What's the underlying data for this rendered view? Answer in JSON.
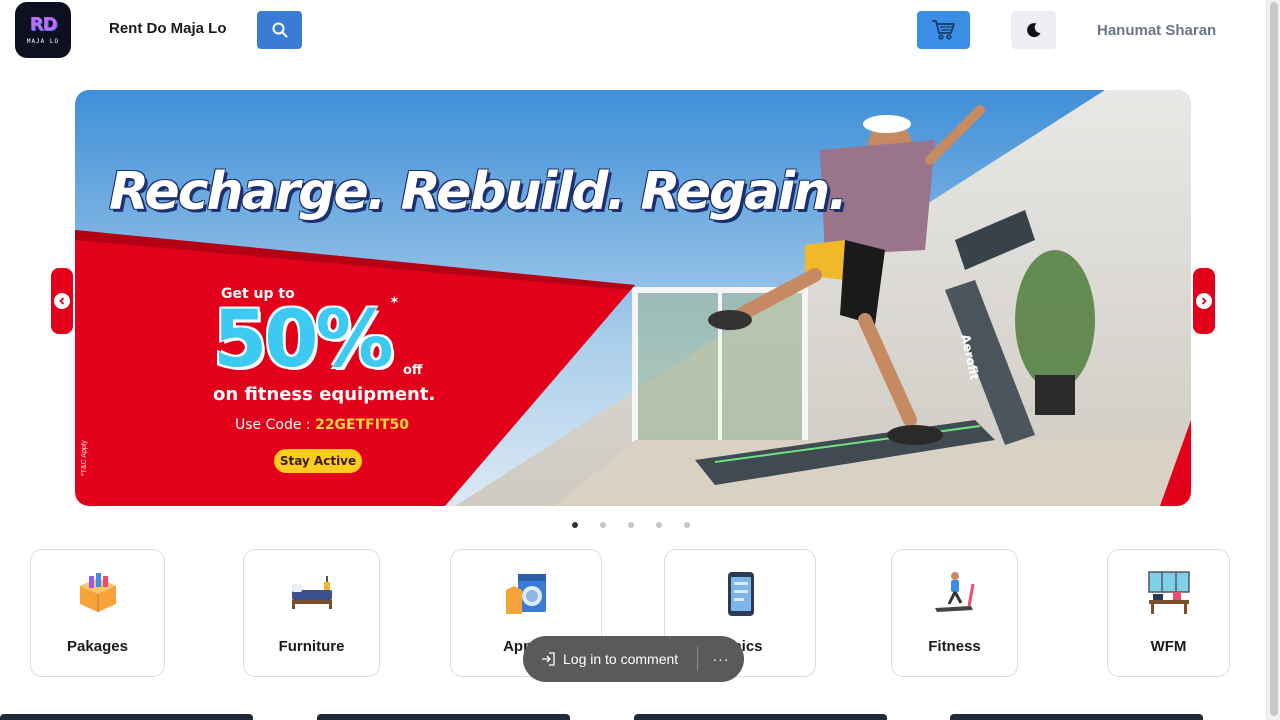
{
  "header": {
    "logo_mark": "RD",
    "logo_text": "MAJA LO",
    "site_title": "Rent Do Maja Lo",
    "user_name": "Hanumat Sharan",
    "icons": {
      "search": "search-icon",
      "cart": "cart-icon",
      "theme": "moon-icon"
    }
  },
  "banner": {
    "slogan": "Recharge. Rebuild. Regain.",
    "promo_prefix": "Get up to",
    "promo_percent": "50%",
    "promo_star": "*",
    "promo_off": "off",
    "promo_line": "on fitness equipment.",
    "code_label": "Use Code :",
    "code_value": "22GETFIT50",
    "cta_label": "Stay Active",
    "tnc": "*T&C Apply",
    "brand": "Aerofit",
    "colors": {
      "red": "#e3001b",
      "cyan": "#3cc9f2",
      "yellow": "#ffcc1f",
      "navy": "#1c2f6e"
    }
  },
  "carousel": {
    "slide_count": 5,
    "active_index": 0
  },
  "categories": [
    {
      "label": "Pakages",
      "icon": "packages-icon"
    },
    {
      "label": "Furniture",
      "icon": "bed-icon"
    },
    {
      "label": "Applia",
      "icon": "washing-machine-icon"
    },
    {
      "label": "ronics",
      "icon": "phone-icon"
    },
    {
      "label": "Fitness",
      "icon": "treadmill-icon"
    },
    {
      "label": "WFM",
      "icon": "office-desk-icon"
    }
  ],
  "comment_bar": {
    "login_label": "Log in to comment",
    "more_label": "···"
  }
}
